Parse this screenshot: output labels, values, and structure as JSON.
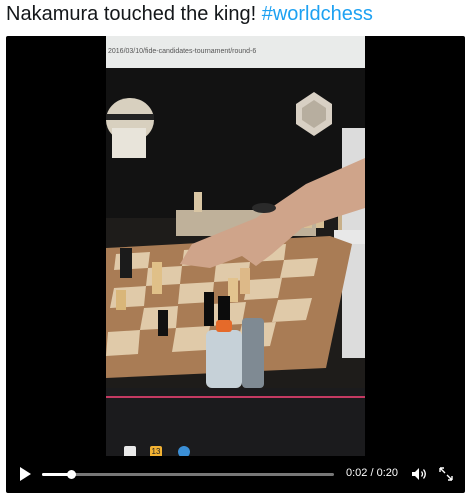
{
  "tweet": {
    "text_before": "Nakamura touched the king! ",
    "hashtag": "#worldchess",
    "hashtag_color": "#1da1f2"
  },
  "video": {
    "frame_url": "2016/03/10/fide-candidates-tournament/round-6",
    "taskbar_icon_label": "13"
  },
  "player": {
    "current_time": "0:02",
    "separator": " / ",
    "total_time": "0:20",
    "progress": 0.1,
    "play_icon": "play-icon",
    "volume_icon": "volume-icon",
    "fullscreen_icon": "fullscreen-icon"
  }
}
